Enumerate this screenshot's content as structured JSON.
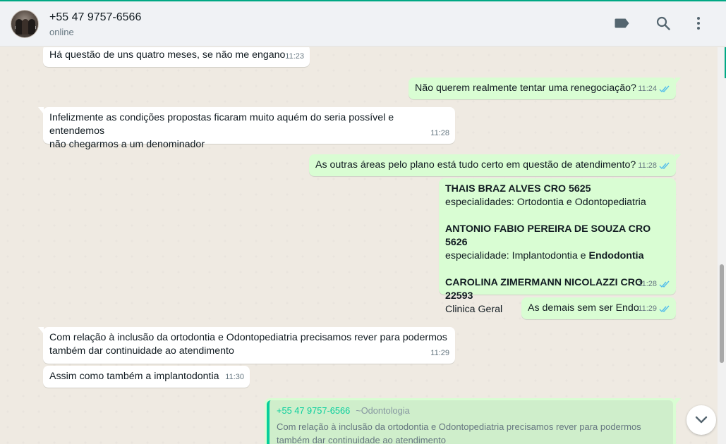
{
  "header": {
    "contact_name": "+55 47 9757-6566",
    "status": "online",
    "icons": [
      "label-icon",
      "search-icon",
      "menu-icon"
    ]
  },
  "messages": [
    {
      "dir": "in",
      "text": "Há questão de uns quatro meses, se não me engano",
      "time": "11:23"
    },
    {
      "dir": "out",
      "text": "Não querem realmente tentar uma renegociação?",
      "time": "11:24",
      "read": true
    },
    {
      "dir": "in",
      "text_line1": "Infelizmente as condições propostas ficaram muito aquém do seria possível e entendemos",
      "text_line2": "não chegarmos a um denominador",
      "time": "11:28"
    },
    {
      "dir": "out",
      "text": "As outras áreas pelo plano está tudo certo em questão de atendimento?",
      "time": "11:28",
      "read": true
    },
    {
      "dir": "out",
      "dentist1_name": "THAIS BRAZ ALVES CRO 5625",
      "dentist1_spec": "especialidades: Ortodontia e Odontopediatria",
      "dentist2_name": "ANTONIO FABIO PEREIRA DE SOUZA CRO 5626",
      "dentist2_spec_prefix": "especialidade: Implantodontia e ",
      "dentist2_spec_bold": "Endodontia",
      "dentist3_name": "CAROLINA ZIMERMANN NICOLAZZI CRO 22593",
      "dentist3_spec": "Clinica Geral",
      "time": "11:28",
      "read": true
    },
    {
      "dir": "out",
      "text": "As demais sem ser Endo",
      "time": "11:29",
      "read": true
    },
    {
      "dir": "in",
      "text_line1": "Com relação à inclusão da ortodontia e Odontopediatria precisamos rever para podermos",
      "text_line2": "também dar continuidade ao atendimento",
      "time": "11:29"
    },
    {
      "dir": "in",
      "text": "Assim como também a implantodontia",
      "time": "11:30"
    }
  ],
  "reply": {
    "quoted_name": "+55 47 9757-6566",
    "quoted_pushname": "~Odontologia",
    "quoted_line1": "Com relação à inclusão da ortodontia e Odontopediatria precisamos rever para podermos",
    "quoted_line2": "também dar continuidade ao atendimento"
  },
  "colors": {
    "accent": "#00a884",
    "incoming_bubble": "#ffffff",
    "outgoing_bubble": "#d9fdd3",
    "read_ticks": "#53bdeb"
  }
}
